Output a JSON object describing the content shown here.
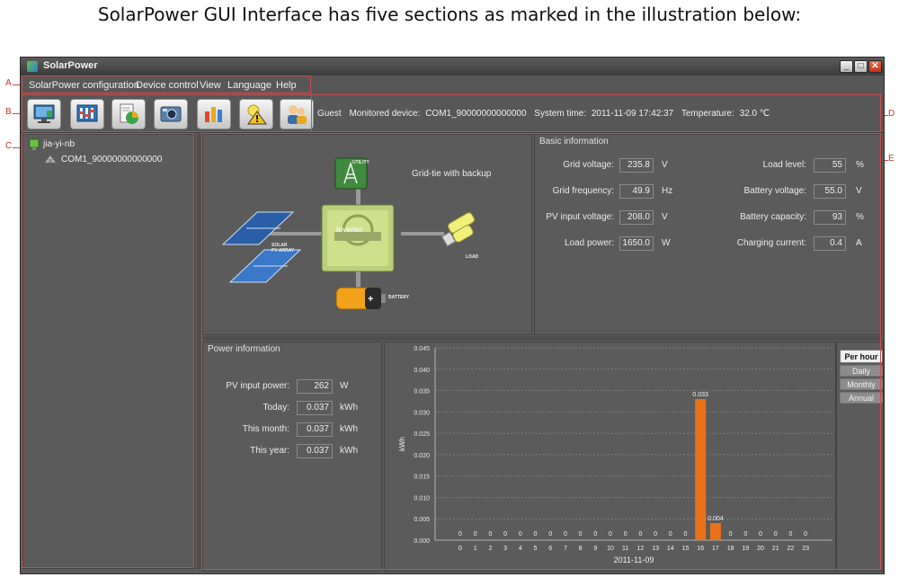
{
  "caption": "SolarPower GUI Interface has five sections as marked in the illustration below:",
  "window": {
    "title": "SolarPower",
    "minimize": "_",
    "maximize": "□",
    "close": "✕"
  },
  "menu": [
    "SolarPower configuration",
    "Device control",
    "View",
    "Language",
    "Help"
  ],
  "toolbar": {
    "buttons": [
      "monitor-icon",
      "settings-icon",
      "report-icon",
      "camera-icon",
      "data-icon",
      "alert-icon",
      "user-icon"
    ]
  },
  "status": {
    "user": "Guest",
    "monitored_label": "Monitored device:",
    "monitored_value": "COM1_90000000000000",
    "time_label": "System time:",
    "time_value": "2011-11-09 17:42:37",
    "temp_label": "Temperature:",
    "temp_value": "32.0 ℃"
  },
  "tree": {
    "root": "jia-yi-nb",
    "device": "COM1_90000000000000"
  },
  "diagram": {
    "mode": "Grid-tie with backup",
    "utility": "UTILITY",
    "inverter": "Inverter",
    "solar": "SOLAR\nPV ARRAY",
    "load": "LOAD",
    "battery": "BATTERY"
  },
  "basic": {
    "title": "Basic information",
    "left": [
      {
        "label": "Grid voltage:",
        "value": "235.8",
        "unit": "V"
      },
      {
        "label": "Grid frequency:",
        "value": "49.9",
        "unit": "Hz"
      },
      {
        "label": "PV input voltage:",
        "value": "208.0",
        "unit": "V"
      },
      {
        "label": "Load power:",
        "value": "1650.0",
        "unit": "W"
      }
    ],
    "right": [
      {
        "label": "Load level:",
        "value": "55",
        "unit": "%"
      },
      {
        "label": "Battery voltage:",
        "value": "55.0",
        "unit": "V"
      },
      {
        "label": "Battery capacity:",
        "value": "93",
        "unit": "%"
      },
      {
        "label": "Charging current:",
        "value": "0.4",
        "unit": "A"
      }
    ]
  },
  "power": {
    "title": "Power information",
    "rows": [
      {
        "label": "PV input power:",
        "value": "262",
        "unit": "W"
      },
      {
        "label": "Today:",
        "value": "0.037",
        "unit": "kWh"
      },
      {
        "label": "This month:",
        "value": "0.037",
        "unit": "kWh"
      },
      {
        "label": "This year:",
        "value": "0.037",
        "unit": "kWh"
      }
    ]
  },
  "tabs": [
    "Per hour",
    "Daily",
    "Monthly",
    "Annual"
  ],
  "markers": [
    "A",
    "B",
    "C",
    "D",
    "E"
  ],
  "colors": {
    "bar": "#e8711a",
    "panel": "#5b5b5b",
    "marker": "#d04a4a"
  },
  "chart_data": {
    "type": "bar",
    "categories": [
      "0",
      "1",
      "2",
      "3",
      "4",
      "5",
      "6",
      "7",
      "8",
      "9",
      "10",
      "11",
      "12",
      "13",
      "14",
      "15",
      "16",
      "17",
      "18",
      "19",
      "20",
      "21",
      "22",
      "23"
    ],
    "values": [
      0,
      0,
      0,
      0,
      0,
      0,
      0,
      0,
      0,
      0,
      0,
      0,
      0,
      0,
      0,
      0,
      0.033,
      0.004,
      0,
      0,
      0,
      0,
      0,
      0
    ],
    "value_labels": [
      "0",
      "0",
      "0",
      "0",
      "0",
      "0",
      "0",
      "0",
      "0",
      "0",
      "0",
      "0",
      "0",
      "0",
      "0",
      "0",
      "0.033",
      "0.004",
      "0",
      "0",
      "0",
      "0",
      "0",
      "0"
    ],
    "yticks": [
      "0.000",
      "0.005",
      "0.010",
      "0.015",
      "0.020",
      "0.025",
      "0.030",
      "0.035",
      "0.040",
      "0.045"
    ],
    "ylim": [
      0,
      0.045
    ],
    "ylabel": "kWh",
    "xlabel": "2011-11-09",
    "grid": true
  }
}
